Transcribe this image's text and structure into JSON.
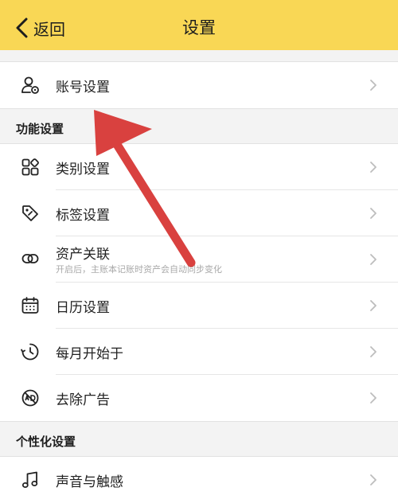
{
  "header": {
    "back_label": "返回",
    "title": "设置"
  },
  "account": {
    "label": "账号设置"
  },
  "sections": {
    "features": "功能设置",
    "personalization": "个性化设置"
  },
  "features": [
    {
      "label": "类别设置"
    },
    {
      "label": "标签设置"
    },
    {
      "label": "资产关联",
      "subtitle": "开启后，主账本记账时资产会自动同步变化"
    },
    {
      "label": "日历设置"
    },
    {
      "label": "每月开始于"
    },
    {
      "label": "去除广告"
    }
  ],
  "personal": [
    {
      "label": "声音与触感"
    }
  ],
  "icons": {
    "back": "chevron-left-icon",
    "account": "account-gear-icon",
    "category": "category-grid-icon",
    "tag": "tag-icon",
    "link": "link-icon",
    "calendar": "calendar-icon",
    "clock": "clock-icon",
    "ad": "ad-block-icon",
    "music": "music-note-icon",
    "chevron": "chevron-right-icon"
  },
  "colors": {
    "topbar": "#f9d755",
    "arrow": "#d9413f"
  }
}
